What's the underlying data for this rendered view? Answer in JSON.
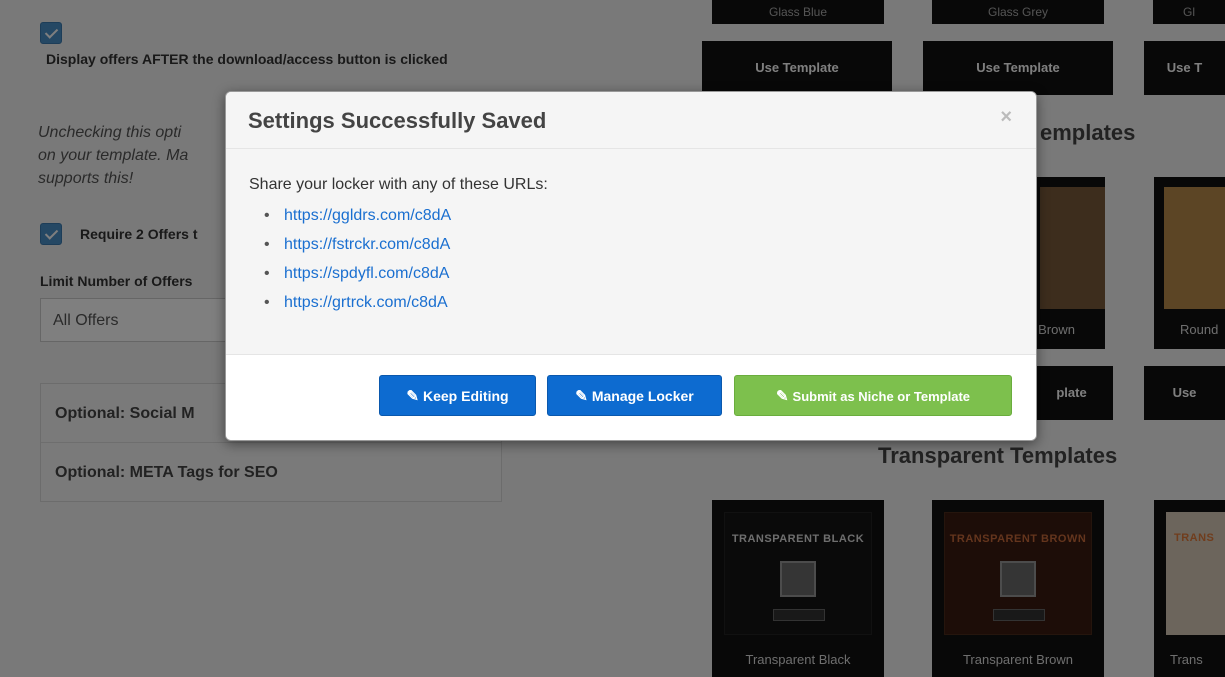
{
  "background": {
    "display_offers_label": "Display offers AFTER the download/access button is clicked",
    "unchecking_note": "Unchecking this option ... on your template. Ma... supports this!",
    "unchecking_note_lines": [
      "Unchecking this opti",
      "on your template. Ma",
      "supports this!"
    ],
    "require_offers_label": "Require 2 Offers t",
    "limit_offers_label": "Limit Number of Offers",
    "limit_offers_value": "All Offers",
    "accordion": [
      "Optional: Social M",
      "Optional: META Tags for SEO"
    ],
    "top_template_labels": [
      "Glass Blue",
      "Glass Grey",
      "Gl"
    ],
    "use_template_label": "Use Template",
    "use_template_partial": "Use T",
    "rounded_section_title": "emplates",
    "rounded_card_labels": [
      "Brown",
      "Round"
    ],
    "rounded_use_partial": "plate",
    "rounded_use_partial2": "Use",
    "transparent_section_title": "Transparent Templates",
    "transparent_cards": [
      {
        "thumb_title": "TRANSPARENT BLACK",
        "label": "Transparent Black",
        "title_color": "#dddddd"
      },
      {
        "thumb_title": "TRANSPARENT BROWN",
        "label": "Transparent Brown",
        "title_color": "#c96a3a"
      },
      {
        "thumb_title": "TRANS",
        "label": "Trans",
        "title_color": "#e07a3a"
      }
    ]
  },
  "modal": {
    "title": "Settings Successfully Saved",
    "close_symbol": "×",
    "intro": "Share your locker with any of these URLs:",
    "urls": [
      "https://ggldrs.com/c8dA",
      "https://fstrckr.com/c8dA",
      "https://spdyfl.com/c8dA",
      "https://grtrck.com/c8dA"
    ],
    "buttons": {
      "keep_editing": "Keep Editing",
      "manage_locker": "Manage Locker",
      "submit": "Submit as Niche or Template"
    }
  },
  "colors": {
    "primary_blue": "#0d6bd0",
    "success_green": "#7dc04d",
    "link_blue": "#1a6fd0"
  }
}
